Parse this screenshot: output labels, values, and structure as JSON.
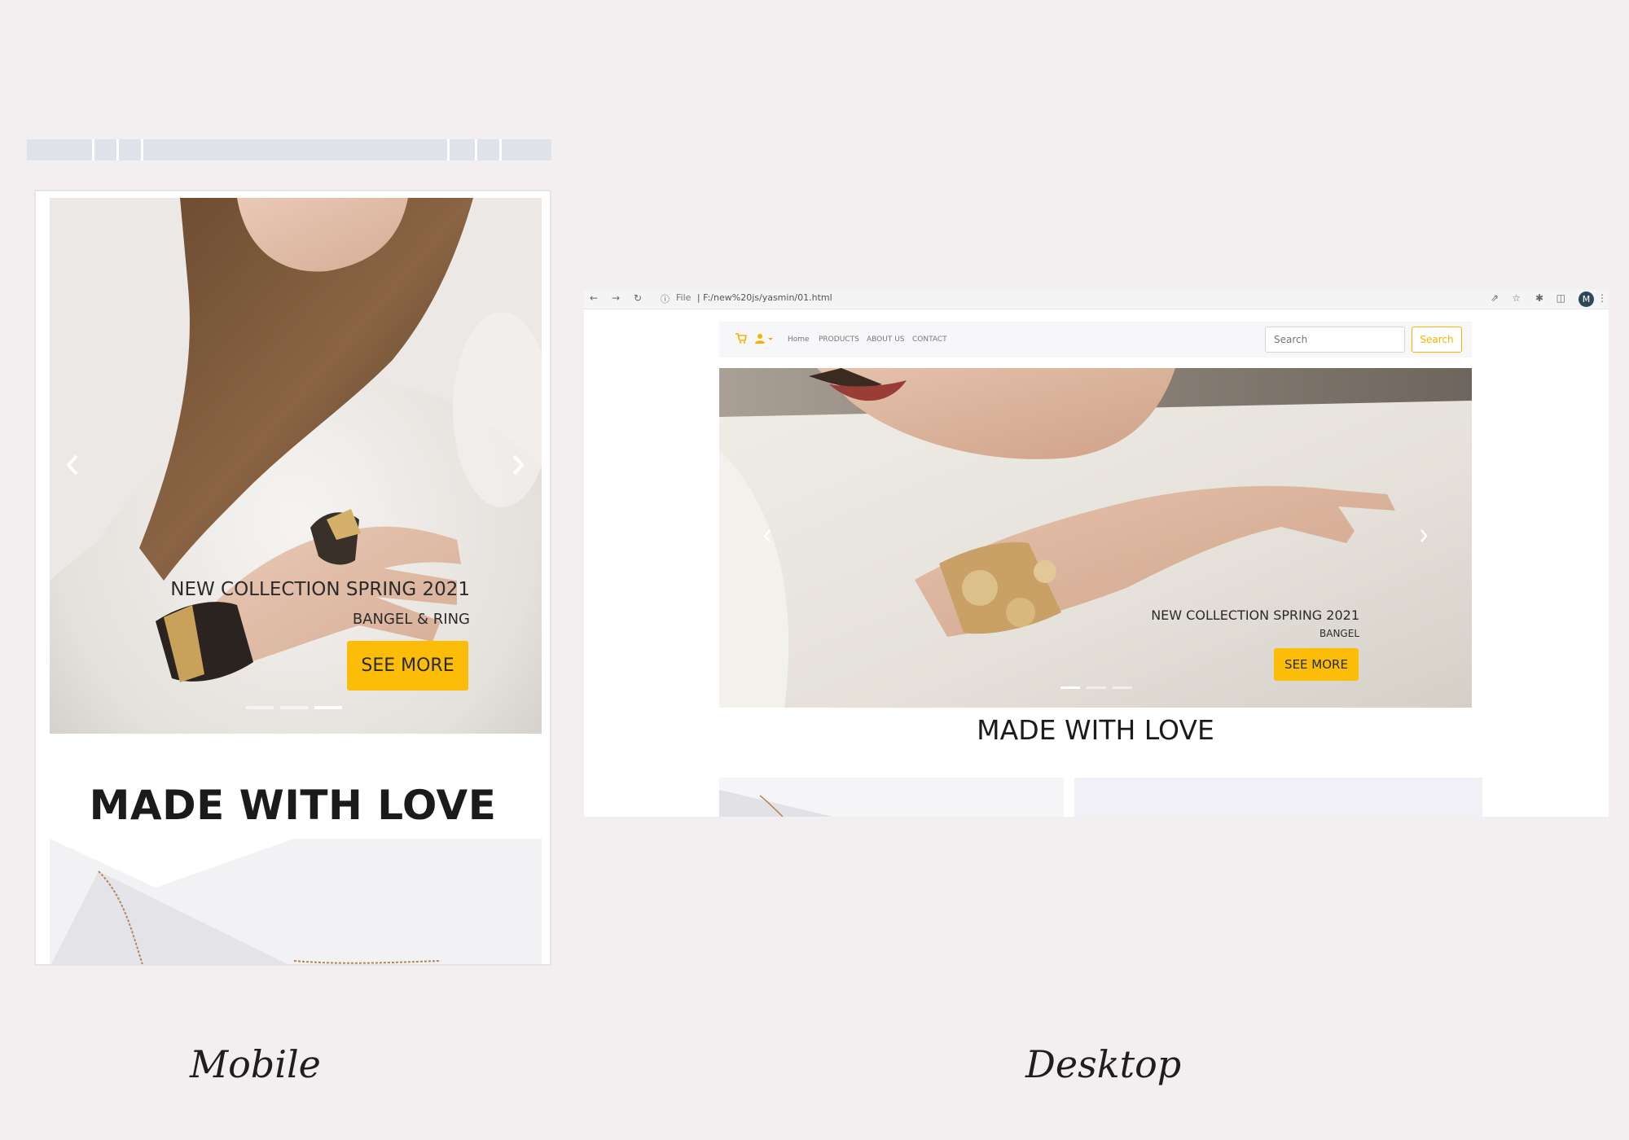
{
  "mobile": {
    "label": "Mobile",
    "hero": {
      "title": "NEW COLLECTION SPRING 2021",
      "subtitle": "BANGEL & RING",
      "button": "SEE MORE",
      "prev_icon": "chevron-left-icon",
      "next_icon": "chevron-right-icon",
      "slide_count": 3,
      "active_slide": 3
    },
    "heading": "MADE WITH LOVE"
  },
  "desktop": {
    "label": "Desktop",
    "browser": {
      "back_icon": "arrow-left-icon",
      "forward_icon": "arrow-right-icon",
      "reload_icon": "reload-icon",
      "info_icon": "info-icon",
      "url_prefix": "File",
      "url": "F:/new%20js/yasmin/01.html",
      "avatar": "M",
      "share_icon": "share-icon",
      "star_icon": "star-icon",
      "extensions_icon": "puzzle-icon",
      "sidepanel_icon": "sidepanel-icon",
      "menu_icon": "kebab-menu-icon"
    },
    "nav": {
      "cart_icon": "cart-icon",
      "user_icon": "user-icon",
      "links": [
        "Home",
        "PRODUCTS",
        "ABOUT US",
        "CONTACT"
      ],
      "search_placeholder": "Search",
      "search_button": "Search"
    },
    "hero": {
      "title": "NEW COLLECTION SPRING 2021",
      "subtitle": "BANGEL",
      "button": "SEE MORE",
      "prev_icon": "chevron-left-icon",
      "next_icon": "chevron-right-icon",
      "slide_count": 3,
      "active_slide": 1
    },
    "heading": "MADE WITH LOVE"
  },
  "colors": {
    "accent": "#fbbd08",
    "background": "#f3eff0"
  }
}
